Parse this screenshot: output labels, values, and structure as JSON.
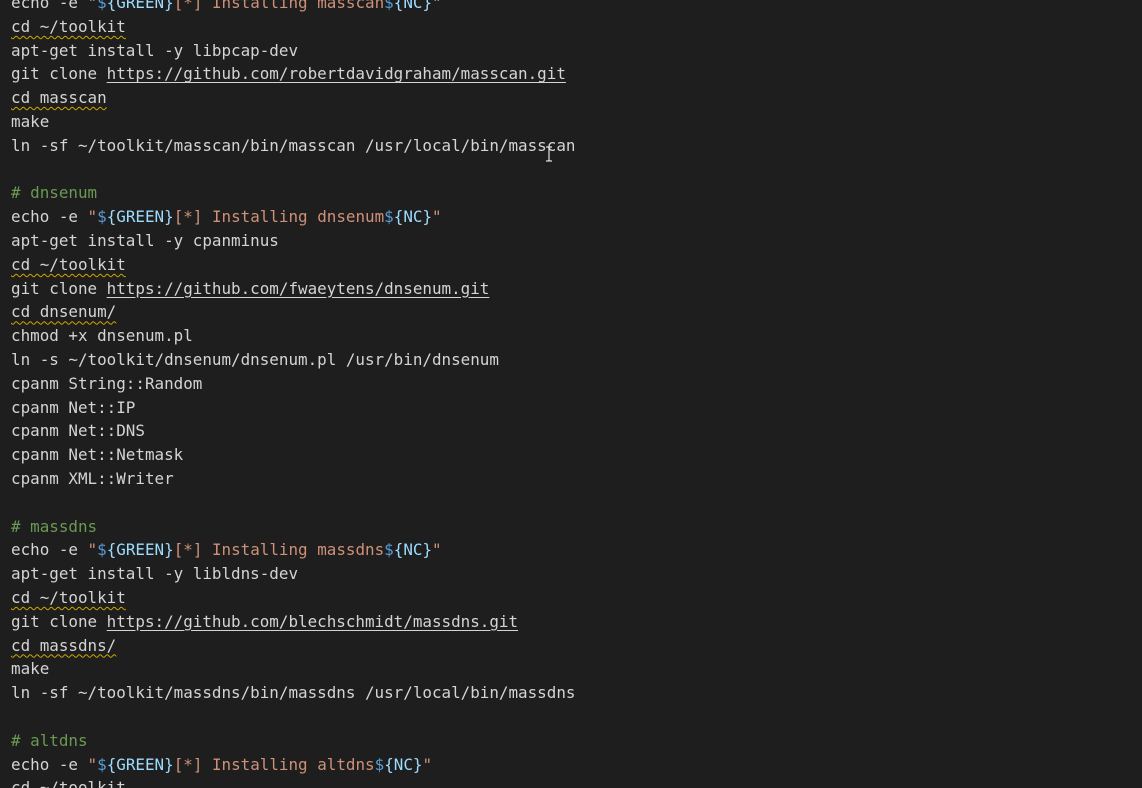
{
  "editor": {
    "language": "shell",
    "colors": {
      "background": "#1e1e1e",
      "text": "#d4d4d4",
      "comment": "#6a9955",
      "string": "#ce9178",
      "variable": "#9cdcfe",
      "keyword": "#569cd6",
      "warning_squiggle": "#cca700"
    },
    "lines": [
      [
        {
          "t": "echo -e ",
          "c": "cmd"
        },
        {
          "t": "\"",
          "c": "string"
        },
        {
          "t": "$",
          "c": "dollar"
        },
        {
          "t": "{GREEN}",
          "c": "var"
        },
        {
          "t": "[*] Installing masscan",
          "c": "string"
        },
        {
          "t": "$",
          "c": "dollar"
        },
        {
          "t": "{NC}",
          "c": "var"
        },
        {
          "t": "\"",
          "c": "string"
        }
      ],
      [
        {
          "t": "cd ~/toolkit",
          "c": "squiggle"
        }
      ],
      [
        {
          "t": "apt-get install -y libpcap-dev",
          "c": "cmd"
        }
      ],
      [
        {
          "t": "git clone ",
          "c": "cmd"
        },
        {
          "t": "https://github.com/robertdavidgraham/masscan.git",
          "c": "link"
        }
      ],
      [
        {
          "t": "cd masscan",
          "c": "squiggle"
        }
      ],
      [
        {
          "t": "make",
          "c": "cmd"
        }
      ],
      [
        {
          "t": "ln -sf ~/toolkit/masscan/bin/masscan /usr/local/bin/masscan",
          "c": "cmd"
        }
      ],
      [],
      [
        {
          "t": "# dnsenum",
          "c": "comment"
        }
      ],
      [
        {
          "t": "echo -e ",
          "c": "cmd"
        },
        {
          "t": "\"",
          "c": "string"
        },
        {
          "t": "$",
          "c": "dollar"
        },
        {
          "t": "{GREEN}",
          "c": "var"
        },
        {
          "t": "[*] Installing dnsenum",
          "c": "string"
        },
        {
          "t": "$",
          "c": "dollar"
        },
        {
          "t": "{NC}",
          "c": "var"
        },
        {
          "t": "\"",
          "c": "string"
        }
      ],
      [
        {
          "t": "apt-get install -y cpanminus",
          "c": "cmd"
        }
      ],
      [
        {
          "t": "cd ~/toolkit",
          "c": "squiggle"
        }
      ],
      [
        {
          "t": "git clone ",
          "c": "cmd"
        },
        {
          "t": "https://github.com/fwaeytens/dnsenum.git",
          "c": "link"
        }
      ],
      [
        {
          "t": "cd dnsenum/",
          "c": "squiggle"
        }
      ],
      [
        {
          "t": "chmod +x dnsenum.pl",
          "c": "cmd"
        }
      ],
      [
        {
          "t": "ln -s ~/toolkit/dnsenum/dnsenum.pl /usr/bin/dnsenum",
          "c": "cmd"
        }
      ],
      [
        {
          "t": "cpanm String::Random",
          "c": "cmd"
        }
      ],
      [
        {
          "t": "cpanm Net::IP",
          "c": "cmd"
        }
      ],
      [
        {
          "t": "cpanm Net::DNS",
          "c": "cmd"
        }
      ],
      [
        {
          "t": "cpanm Net::Netmask",
          "c": "cmd"
        }
      ],
      [
        {
          "t": "cpanm XML::Writer",
          "c": "cmd"
        }
      ],
      [],
      [
        {
          "t": "# massdns",
          "c": "comment"
        }
      ],
      [
        {
          "t": "echo -e ",
          "c": "cmd"
        },
        {
          "t": "\"",
          "c": "string"
        },
        {
          "t": "$",
          "c": "dollar"
        },
        {
          "t": "{GREEN}",
          "c": "var"
        },
        {
          "t": "[*] Installing massdns",
          "c": "string"
        },
        {
          "t": "$",
          "c": "dollar"
        },
        {
          "t": "{NC}",
          "c": "var"
        },
        {
          "t": "\"",
          "c": "string"
        }
      ],
      [
        {
          "t": "apt-get install -y libldns-dev",
          "c": "cmd"
        }
      ],
      [
        {
          "t": "cd ~/toolkit",
          "c": "squiggle"
        }
      ],
      [
        {
          "t": "git clone ",
          "c": "cmd"
        },
        {
          "t": "https://github.com/blechschmidt/massdns.git",
          "c": "link"
        }
      ],
      [
        {
          "t": "cd massdns/",
          "c": "squiggle"
        }
      ],
      [
        {
          "t": "make",
          "c": "cmd"
        }
      ],
      [
        {
          "t": "ln -sf ~/toolkit/massdns/bin/massdns /usr/local/bin/massdns",
          "c": "cmd"
        }
      ],
      [],
      [
        {
          "t": "# altdns",
          "c": "comment"
        }
      ],
      [
        {
          "t": "echo -e ",
          "c": "cmd"
        },
        {
          "t": "\"",
          "c": "string"
        },
        {
          "t": "$",
          "c": "dollar"
        },
        {
          "t": "{GREEN}",
          "c": "var"
        },
        {
          "t": "[*] Installing altdns",
          "c": "string"
        },
        {
          "t": "$",
          "c": "dollar"
        },
        {
          "t": "{NC}",
          "c": "var"
        },
        {
          "t": "\"",
          "c": "string"
        }
      ],
      [
        {
          "t": "cd ~/toolkit",
          "c": "squiggle"
        }
      ]
    ]
  },
  "cursor": {
    "icon": "text-cursor-icon",
    "glyph": "I"
  }
}
